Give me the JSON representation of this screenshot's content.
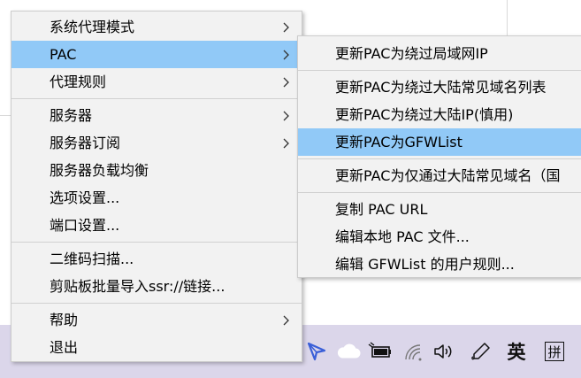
{
  "main_menu": {
    "items": [
      {
        "label": "系统代理模式",
        "submenu": true
      },
      {
        "label": "PAC",
        "submenu": true
      },
      {
        "label": "代理规则",
        "submenu": true
      },
      {
        "label": "服务器",
        "submenu": true
      },
      {
        "label": "服务器订阅",
        "submenu": true
      },
      {
        "label": "服务器负载均衡",
        "submenu": false
      },
      {
        "label": "选项设置...",
        "submenu": false
      },
      {
        "label": "端口设置...",
        "submenu": false
      },
      {
        "label": "二维码扫描...",
        "submenu": false
      },
      {
        "label": "剪贴板批量导入ssr://链接...",
        "submenu": false
      },
      {
        "label": "帮助",
        "submenu": true
      },
      {
        "label": "退出",
        "submenu": false
      }
    ]
  },
  "pac_submenu": {
    "items": [
      {
        "label": "更新PAC为绕过局域网IP"
      },
      {
        "label": "更新PAC为绕过大陆常见域名列表"
      },
      {
        "label": "更新PAC为绕过大陆IP(慎用)"
      },
      {
        "label": "更新PAC为GFWList"
      },
      {
        "label": "更新PAC为仅通过大陆常见域名（国"
      },
      {
        "label": "复制 PAC URL"
      },
      {
        "label": "编辑本地 PAC 文件..."
      },
      {
        "label": "编辑 GFWList 的用户规则..."
      }
    ]
  },
  "tray": {
    "icons": [
      "send-icon",
      "cloud-icon",
      "battery-plug-icon",
      "wifi-icon",
      "speaker-icon",
      "pen-icon"
    ],
    "ime_mode": "英",
    "ime_pinyin": "拼"
  },
  "colors": {
    "menu_bg": "#f2f2f2",
    "highlight": "#91c9f7",
    "taskbar": "#dbd6ea",
    "tray_send_icon": "#3a5fd8"
  }
}
